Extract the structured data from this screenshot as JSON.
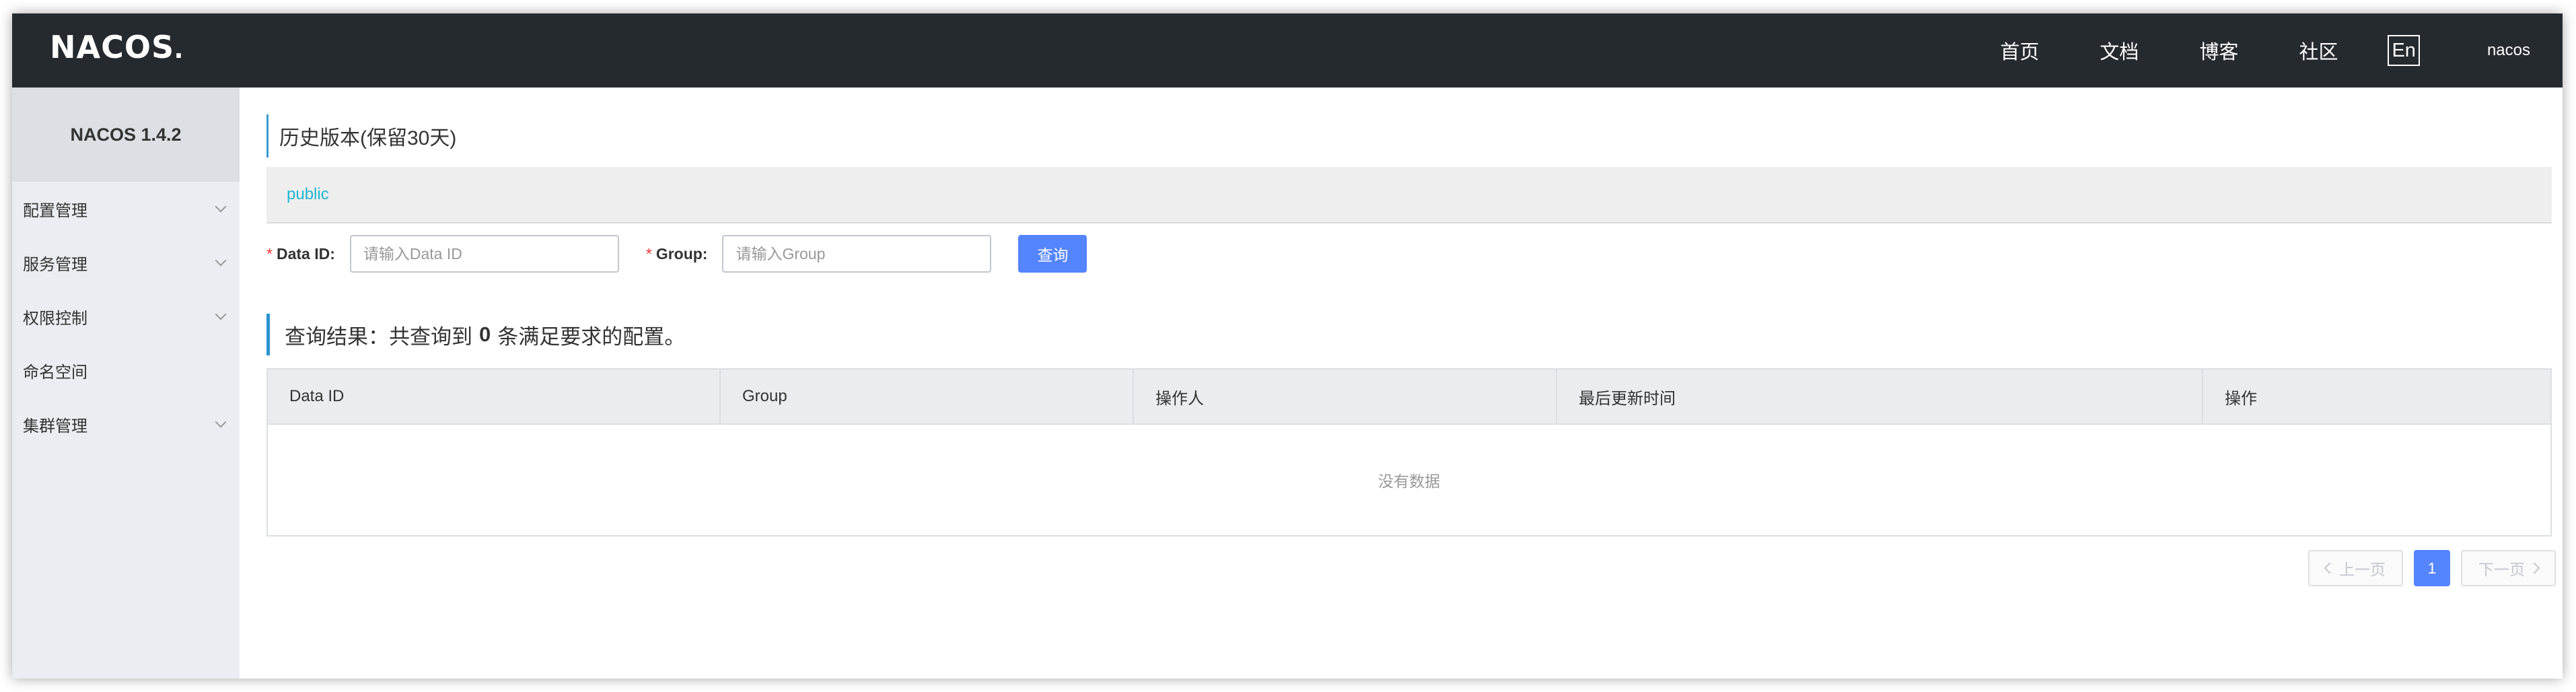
{
  "header": {
    "logo": "NACOS",
    "nav": [
      "首页",
      "文档",
      "博客",
      "社区"
    ],
    "lang": "En",
    "user": "nacos"
  },
  "sidebar": {
    "version": "NACOS 1.4.2",
    "items": [
      {
        "label": "配置管理",
        "expandable": true
      },
      {
        "label": "服务管理",
        "expandable": true
      },
      {
        "label": "权限控制",
        "expandable": true
      },
      {
        "label": "命名空间",
        "expandable": false
      },
      {
        "label": "集群管理",
        "expandable": true
      }
    ]
  },
  "main": {
    "page_title": "历史版本(保留30天)",
    "namespace": "public",
    "search": {
      "data_id_label": "Data ID:",
      "data_id_placeholder": "请输入Data ID",
      "data_id_value": "",
      "group_label": "Group:",
      "group_placeholder": "请输入Group",
      "group_value": "",
      "required_mark": "*",
      "query_button": "查询"
    },
    "result": {
      "prefix": "查询结果：共查询到",
      "count": "0",
      "suffix": "条满足要求的配置。"
    },
    "table": {
      "columns": [
        "Data ID",
        "Group",
        "操作人",
        "最后更新时间",
        "操作"
      ],
      "empty_text": "没有数据"
    },
    "pagination": {
      "prev": "上一页",
      "current": "1",
      "next": "下一页"
    }
  },
  "colors": {
    "header_bg": "#252a2f",
    "sidebar_bg": "#eaedf1",
    "accent": "#5584ff",
    "namespace_link": "#1fb5d0"
  }
}
